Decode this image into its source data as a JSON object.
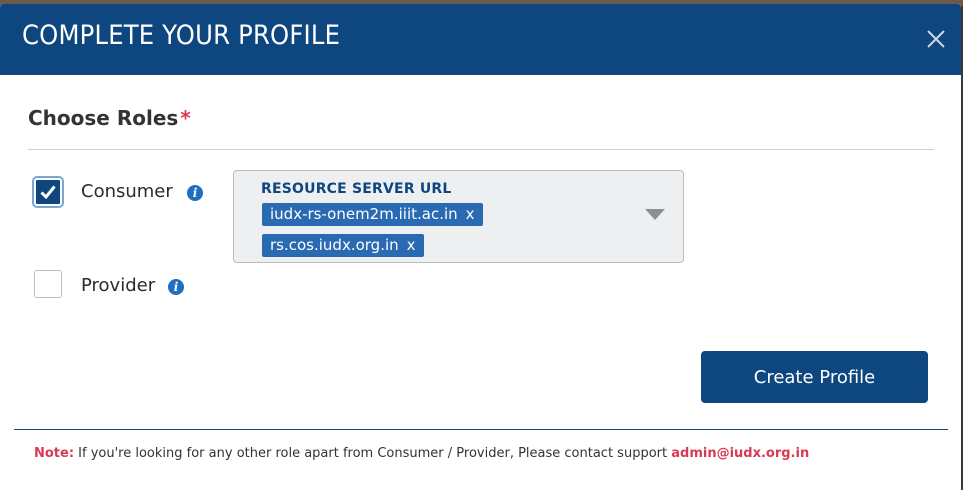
{
  "modal": {
    "title": "COMPLETE YOUR PROFILE",
    "close_icon": "close-icon"
  },
  "roles": {
    "section_title": "Choose Roles",
    "required_mark": "*",
    "consumer": {
      "label": "Consumer",
      "checked": true,
      "info_glyph": "i"
    },
    "provider": {
      "label": "Provider",
      "checked": false,
      "info_glyph": "i"
    }
  },
  "resource_server": {
    "label": "RESOURCE SERVER URL",
    "selected": [
      {
        "text": "iudx-rs-onem2m.iiit.ac.in",
        "remove": "x"
      },
      {
        "text": "rs.cos.iudx.org.in",
        "remove": "x"
      }
    ]
  },
  "actions": {
    "create_label": "Create Profile"
  },
  "note": {
    "label": "Note:",
    "text": " If you're looking for any other role apart from Consumer / Provider, Please contact support ",
    "email": "admin@iudx.org.in"
  },
  "colors": {
    "primary": "#0e4680",
    "chip": "#2a6ab3",
    "accent_red": "#d83a52",
    "info": "#1f6fc0"
  }
}
